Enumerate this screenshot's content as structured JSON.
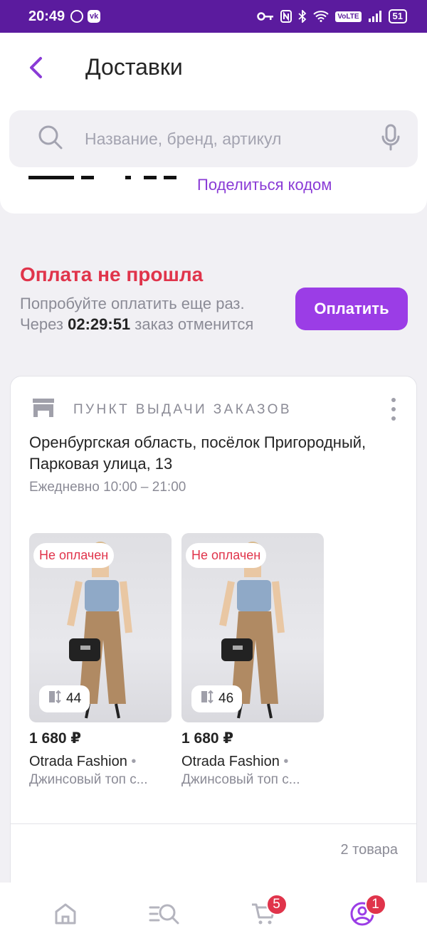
{
  "status_bar": {
    "time": "20:49",
    "vk_label": "vk",
    "volte": "VoLTE",
    "battery": "51"
  },
  "header": {
    "title": "Доставки"
  },
  "search": {
    "placeholder": "Название, бренд, артикул"
  },
  "share_code": "Поделиться кодом",
  "payment": {
    "title": "Оплата не прошла",
    "text_before": "Попробуйте оплатить еще раз. Через ",
    "timer": "02:29:51",
    "text_after": " заказ отменится",
    "button": "Оплатить"
  },
  "order": {
    "pickup_label": "ПУНКТ ВЫДАЧИ ЗАКАЗОВ",
    "address": "Оренбургская область, посёлок Пригородный, Парковая улица, 13",
    "hours": "Ежедневно 10:00 – 21:00",
    "items": [
      {
        "status": "Не оплачен",
        "size": "44",
        "price": "1 680 ₽",
        "brand": "Otrada Fashion",
        "name": "Джинсовый топ с..."
      },
      {
        "status": "Не оплачен",
        "size": "46",
        "price": "1 680 ₽",
        "brand": "Otrada Fashion",
        "name": "Джинсовый топ с..."
      }
    ],
    "items_count": "2 товара"
  },
  "bottom_nav": {
    "cart_badge": "5",
    "profile_badge": "1"
  },
  "colors": {
    "brand_purple": "#9b3de6",
    "status_bar": "#5b1b9e",
    "error_red": "#e0344b",
    "link_purple": "#8a3bd6"
  }
}
